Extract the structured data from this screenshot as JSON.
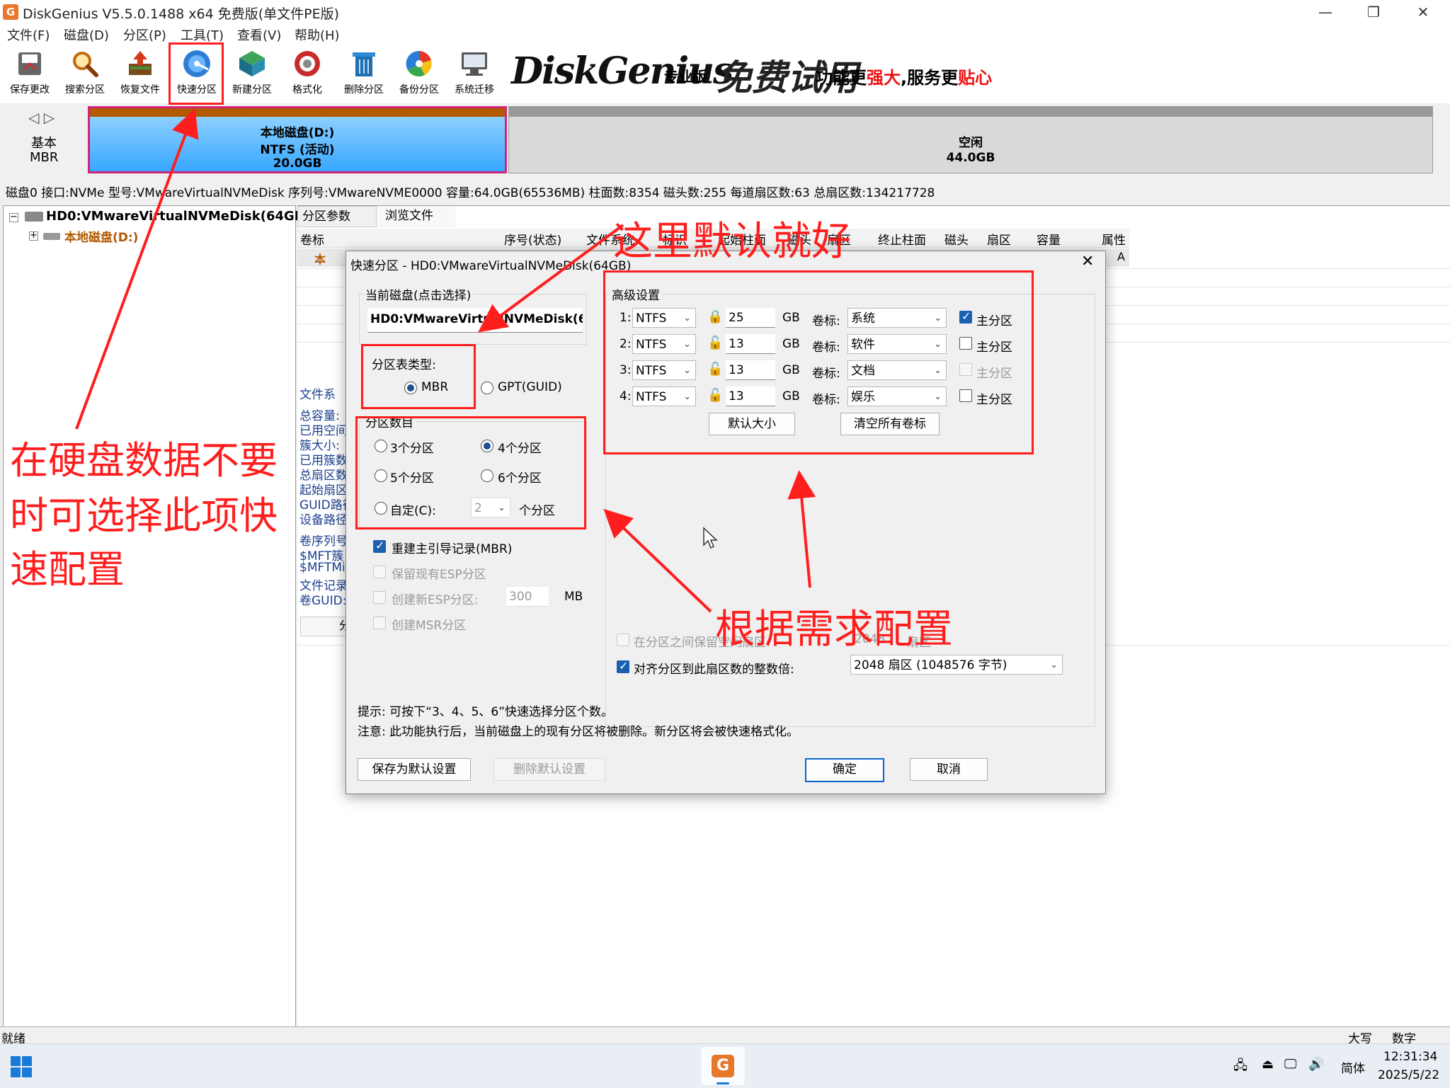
{
  "window": {
    "title": "DiskGenius V5.5.0.1488 x64 免费版(单文件PE版)",
    "logo_text": "G",
    "controls": {
      "minimize": "—",
      "restore": "❐",
      "close": "✕"
    }
  },
  "menubar": [
    "文件(F)",
    "磁盘(D)",
    "分区(P)",
    "工具(T)",
    "查看(V)",
    "帮助(H)"
  ],
  "toolbar": [
    {
      "label": "保存更改",
      "icon": "save-icon"
    },
    {
      "label": "搜索分区",
      "icon": "search-icon"
    },
    {
      "label": "恢复文件",
      "icon": "recover-icon"
    },
    {
      "label": "快速分区",
      "icon": "quick-partition-icon"
    },
    {
      "label": "新建分区",
      "icon": "new-partition-icon"
    },
    {
      "label": "格式化",
      "icon": "format-icon"
    },
    {
      "label": "删除分区",
      "icon": "delete-icon"
    },
    {
      "label": "备份分区",
      "icon": "backup-icon"
    },
    {
      "label": "系统迁移",
      "icon": "migrate-icon"
    }
  ],
  "banner": {
    "brand": "DiskGenius",
    "edition": "专业版",
    "promo": "免费试用",
    "slogan_a": "功能更",
    "slogan_b": "强大",
    "slogan_c": ",服务更",
    "slogan_d": "贴心"
  },
  "diskmap": {
    "nav": "◁ ▷",
    "disk_type": "基本",
    "disk_table": "MBR",
    "partition": {
      "name": "本地磁盘(D:)",
      "fs": "NTFS (活动)",
      "size": "20.0GB"
    },
    "free": {
      "name": "空闲",
      "size": "44.0GB"
    }
  },
  "diskinfo": "磁盘0 接口:NVMe  型号:VMwareVirtualNVMeDisk  序列号:VMwareNVME0000  容量:64.0GB(65536MB)  柱面数:8354  磁头数:255  每道扇区数:63  总扇区数:134217728",
  "tree": {
    "disk": "HD0:VMwareVirtualNVMeDisk(64GB)",
    "partition": "本地磁盘(D:)"
  },
  "right_tabs": [
    "分区参数",
    "浏览文件"
  ],
  "columns": [
    "卷标",
    "序号(状态)",
    "文件系统",
    "标识",
    "起始柱面",
    "磁头",
    "扇区",
    "终止柱面",
    "磁头",
    "扇区",
    "容量",
    "属性"
  ],
  "row_partial": {
    "label": "本",
    "attr": "A"
  },
  "left_props": [
    "文件系",
    "总容量:",
    "已用空间",
    "簇大小:",
    "已用簇数",
    "总扇区数",
    "起始扇区",
    "GUID路径",
    "设备路径",
    "卷序列号",
    "$MFT簇",
    "$MFTMi",
    "文件记录",
    "卷GUID:"
  ],
  "left_btn_partial": "分",
  "status": {
    "text": "就绪",
    "caps": "大写",
    "num": "数字"
  },
  "taskbar": {
    "time": "12:31:34",
    "date": "2025/5/22",
    "ime": "简体",
    "app_icon": "G"
  },
  "dialog": {
    "title": "快速分区 - HD0:VMwareVirtualNVMeDisk(64GB)",
    "close": "✕",
    "current_disk_label": "当前磁盘(点击选择)",
    "current_disk_value": "HD0:VMwareVirtualNVMeDisk(64",
    "table_type_label": "分区表类型:",
    "table_types": [
      "MBR",
      "GPT(GUID)"
    ],
    "count_label": "分区数目",
    "counts": [
      "3个分区",
      "4个分区",
      "5个分区",
      "6个分区"
    ],
    "custom_label": "自定(C):",
    "custom_value": "2",
    "custom_unit": "个分区",
    "opt_rebuild_mbr": "重建主引导记录(MBR)",
    "opt_keep_esp": "保留现有ESP分区",
    "opt_new_esp": "创建新ESP分区:",
    "opt_new_esp_size": "300",
    "opt_new_esp_unit": "MB",
    "opt_msr": "创建MSR分区",
    "adv_label": "高级设置",
    "partitions": [
      {
        "idx": "1:",
        "fs": "NTFS",
        "size": "25",
        "unit": "GB",
        "vol_label": "卷标:",
        "vol": "系统",
        "primary": "主分区",
        "checked": true,
        "disabled": false,
        "locked": true
      },
      {
        "idx": "2:",
        "fs": "NTFS",
        "size": "13",
        "unit": "GB",
        "vol_label": "卷标:",
        "vol": "软件",
        "primary": "主分区",
        "checked": false,
        "disabled": false,
        "locked": false
      },
      {
        "idx": "3:",
        "fs": "NTFS",
        "size": "13",
        "unit": "GB",
        "vol_label": "卷标:",
        "vol": "文档",
        "primary": "主分区",
        "checked": false,
        "disabled": true,
        "locked": false
      },
      {
        "idx": "4:",
        "fs": "NTFS",
        "size": "13",
        "unit": "GB",
        "vol_label": "卷标:",
        "vol": "娱乐",
        "primary": "主分区",
        "checked": false,
        "disabled": false,
        "locked": false
      }
    ],
    "btn_default_size": "默认大小",
    "btn_clear_labels": "清空所有卷标",
    "opt_reserve_free": "在分区之间保留空闲扇区:",
    "opt_reserve_value": "2048",
    "opt_reserve_unit": "扇区",
    "opt_align": "对齐分区到此扇区数的整数倍:",
    "opt_align_value": "2048 扇区 (1048576 字节)",
    "hint1": "提示: 可按下“3、4、5、6”快速选择分区个数。",
    "hint2": "注意: 此功能执行后，当前磁盘上的现有分区将被删除。新分区将会被快速格式化。",
    "btn_save_default": "保存为默认设置",
    "btn_delete_default": "删除默认设置",
    "btn_ok": "确定",
    "btn_cancel": "取消"
  },
  "annotations": {
    "top": "这里默认就好",
    "left": [
      "在硬盘数据不要",
      "时可选择此项快",
      "速配置"
    ],
    "bottom": "根据需求配置"
  },
  "colors": {
    "annotation": "#ff1e1e",
    "partition_fill": "#5ab8ff",
    "partition_border": "#d1247a",
    "dialog_bg": "#f0f0f0"
  }
}
